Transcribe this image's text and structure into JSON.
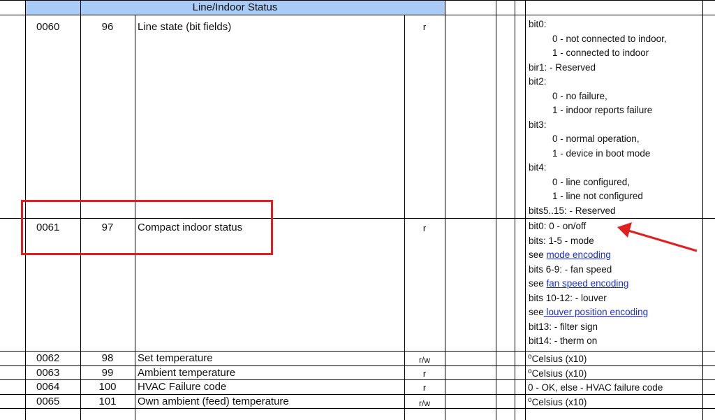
{
  "section_header": "Line/Indoor Status",
  "rows": [
    {
      "addr": "0060",
      "num": "96",
      "name": "Line state (bit fields)",
      "access": "r"
    },
    {
      "addr": "0061",
      "num": "97",
      "name": "Compact indoor status",
      "access": "r"
    },
    {
      "addr": "0062",
      "num": "98",
      "name": "Set temperature",
      "access": "r/w"
    },
    {
      "addr": "0063",
      "num": "99",
      "name": "Ambient temperature",
      "access": "r"
    },
    {
      "addr": "0064",
      "num": "100",
      "name": "HVAC Failure code",
      "access": "r"
    },
    {
      "addr": "0065",
      "num": "101",
      "name": "Own ambient (feed) temperature",
      "access": "r/w"
    }
  ],
  "line_state_desc": [
    "bit0:",
    "0 - not connected to indoor,",
    "1 - connected to indoor",
    "bir1: - Reserved",
    "bit2:",
    "0 - no failure,",
    "1 - indoor reports failure",
    "bit3:",
    "0 - normal operation,",
    "1 - device in boot mode",
    "bit4:",
    "0 - line configured,",
    "1 - line not configured",
    "bits5..15: - Reserved"
  ],
  "compact_desc": {
    "l1": "bit0: 0  - on/off",
    "l2": "bits: 1-5 - mode",
    "see": "see ",
    "see_nospace": "see",
    "mode_link": "mode encoding",
    "l4": "bits 6-9: - fan speed",
    "fan_link": "fan speed encoding",
    "l6": "bits 10-12: - louver",
    "louver_link": " louver position encoding",
    "l8": "bit13: - filter sign",
    "l9": "bit14: - therm on"
  },
  "temp_desc": {
    "deg": "o",
    "text": "Celsius (x10)"
  },
  "failure_desc": "0 - OK, else - HVAC failure code",
  "annotation_color": "#e02020"
}
